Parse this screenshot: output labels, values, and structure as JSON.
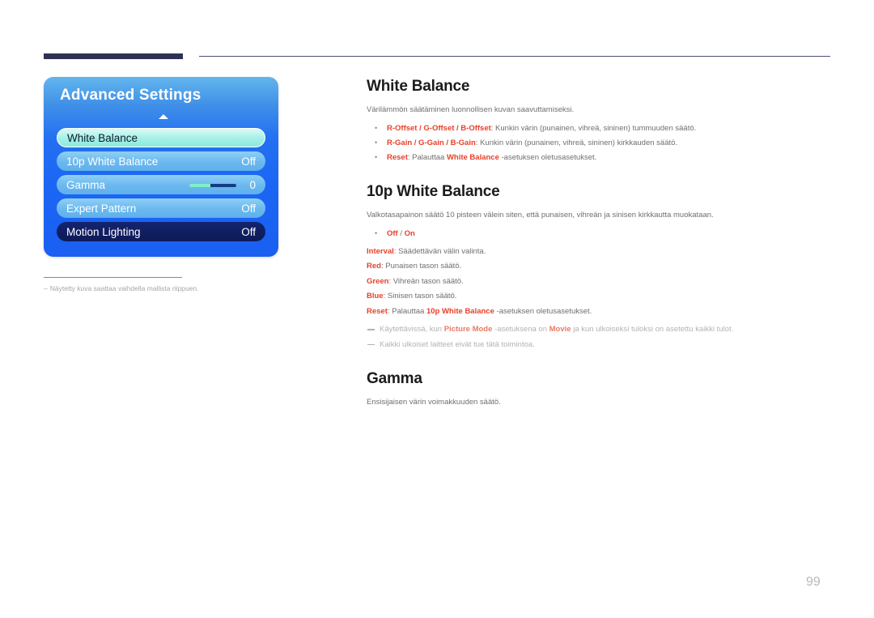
{
  "header": {
    "rule_left_name": "header-accent-bar",
    "rule_right_name": "header-rule"
  },
  "osd": {
    "title": "Advanced Settings",
    "up_arrow_icon": "chevron-up-icon",
    "rows": [
      {
        "label": "White Balance",
        "value": "",
        "state": "selected"
      },
      {
        "label": "10p White Balance",
        "value": "Off",
        "state": "normal"
      },
      {
        "label": "Gamma",
        "value": "0",
        "state": "normal",
        "slider": 45
      },
      {
        "label": "Expert Pattern",
        "value": "Off",
        "state": "normal"
      },
      {
        "label": "Motion Lighting",
        "value": "Off",
        "state": "dark"
      }
    ],
    "colors": {
      "panel_top": "#63b6ec",
      "panel_bottom": "#1a5ff2",
      "selected_row": "#a4f0e6",
      "normal_row": "#6ab8ef",
      "dark_row": "#0d1a57",
      "slider_fill": "#7ff0c4",
      "slider_track": "#143c86"
    },
    "footnote_dash": "–",
    "footnote": "Näytetty kuva saattaa vaihdella mallista riippuen."
  },
  "content": {
    "section1": {
      "title": "White Balance",
      "lead": "Värilämmön säätäminen luonnollisen kuvan saavuttamiseksi.",
      "bullets": [
        {
          "key": "R-Offset / G-Offset / B-Offset",
          "rest": ": Kunkin värin (punainen, vihreä, sininen) tummuuden säätö."
        },
        {
          "key": "R-Gain / G-Gain / B-Gain",
          "rest": ": Kunkin värin (punainen, vihreä, sininen) kirkkauden säätö."
        },
        {
          "key": "Reset",
          "rest_a": ": Palauttaa ",
          "key2": "White Balance",
          "rest_b": " -asetuksen oletusasetukset."
        }
      ]
    },
    "section2": {
      "title": "10p White Balance",
      "lead": "Valkotasapainon säätö 10 pisteen välein siten, että punaisen, vihreän ja sinisen kirkkautta muokataan.",
      "bullet": {
        "key": "Off",
        "sep": " / ",
        "key2": "On"
      },
      "definitions": [
        {
          "key": "Interval",
          "rest": ": Säädettävän välin valinta."
        },
        {
          "key": "Red",
          "rest": ": Punaisen tason säätö."
        },
        {
          "key": "Green",
          "rest": ": Vihreän tason säätö."
        },
        {
          "key": "Blue",
          "rest": ": Sinisen tason säätö."
        }
      ],
      "reset": {
        "key": "Reset",
        "rest_a": ": Palauttaa ",
        "key2": "10p White Balance",
        "rest_b": " -asetuksen oletusasetukset."
      },
      "notes": [
        {
          "part_a": "Käytettävissä, kun ",
          "key": "Picture Mode",
          "part_b": " -asetuksena on ",
          "key2": "Movie",
          "part_c": " ja kun ulkoiseksi tuloksi on asetettu kaikki tulot."
        },
        {
          "part_a": "Kaikki ulkoiset laitteet eivät tue tätä toimintoa.",
          "key": "",
          "part_b": "",
          "key2": "",
          "part_c": ""
        }
      ]
    },
    "section3": {
      "title": "Gamma",
      "lead": "Ensisijaisen värin voimakkuuden säätö."
    }
  },
  "page": {
    "number": "99"
  }
}
